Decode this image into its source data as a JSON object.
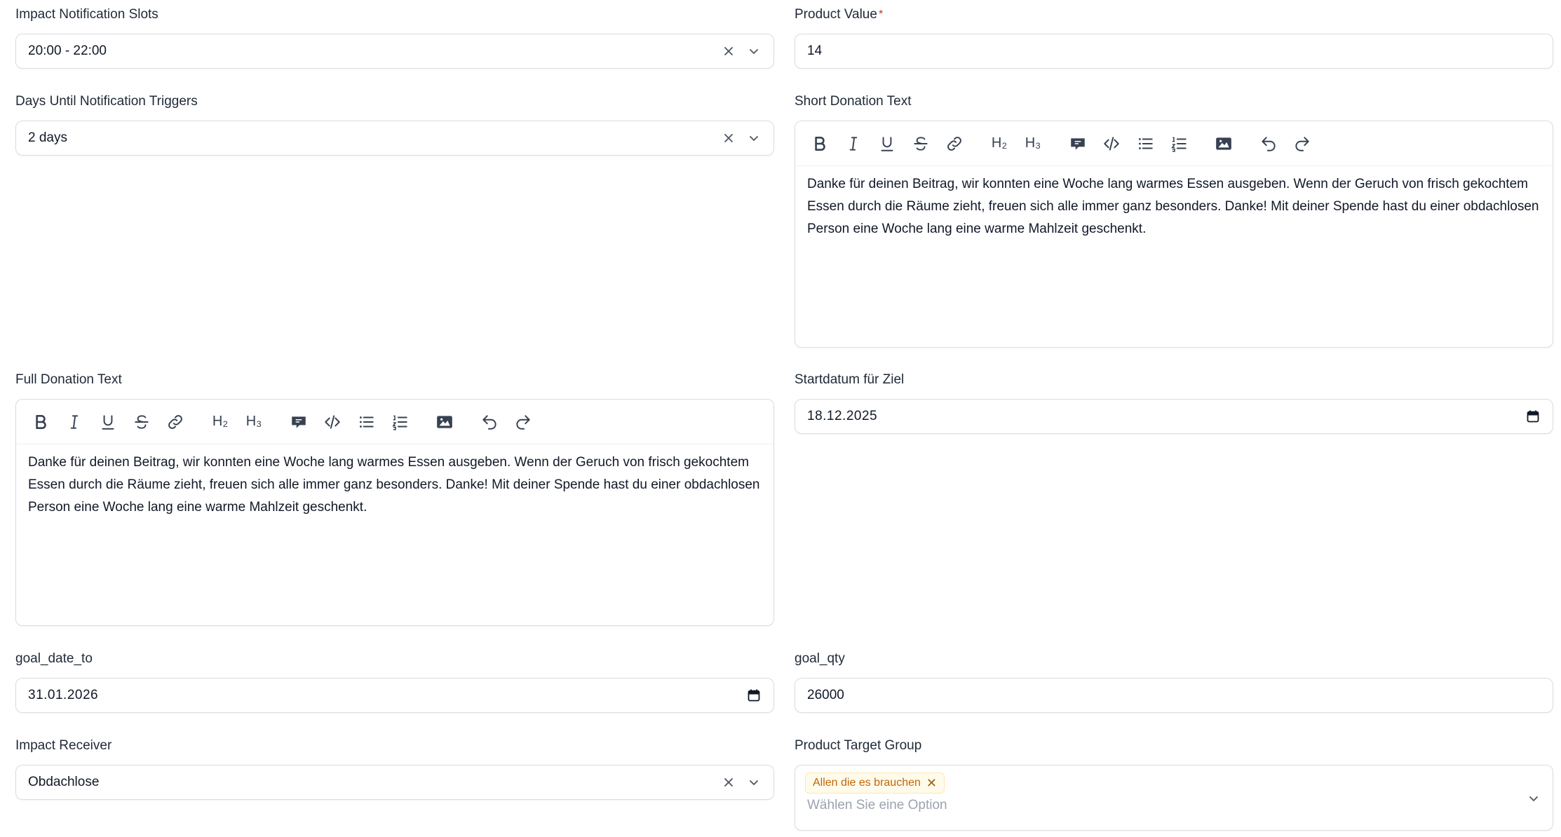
{
  "impact_notification_slots": {
    "label": "Impact Notification Slots",
    "value": "20:00 - 22:00"
  },
  "product_value": {
    "label": "Product Value",
    "required_mark": "*",
    "value": "14"
  },
  "days_until_notification": {
    "label": "Days Until Notification Triggers",
    "value": "2 days"
  },
  "short_donation_text": {
    "label": "Short Donation Text",
    "content": "Danke für deinen Beitrag, wir konnten eine Woche lang warmes Essen ausgeben. Wenn der Geruch von frisch gekochtem Essen durch die Räume zieht, freuen sich alle immer ganz besonders. Danke! Mit deiner Spende hast du einer obdachlosen Person eine Woche lang eine warme Mahlzeit geschenkt."
  },
  "full_donation_text": {
    "label": "Full Donation Text",
    "content": "Danke für deinen Beitrag, wir konnten eine Woche lang warmes Essen ausgeben. Wenn der Geruch von frisch gekochtem Essen durch die Räume zieht, freuen sich alle immer ganz besonders. Danke! Mit deiner Spende hast du einer obdachlosen Person eine Woche lang eine warme Mahlzeit geschenkt."
  },
  "startdatum": {
    "label": "Startdatum für Ziel",
    "value": "18.12.2025"
  },
  "goal_date_to": {
    "label": "goal_date_to",
    "value": "31.01.2026"
  },
  "goal_qty": {
    "label": "goal_qty",
    "value": "26000"
  },
  "impact_receiver": {
    "label": "Impact Receiver",
    "value": "Obdachlose"
  },
  "product_target_group": {
    "label": "Product Target Group",
    "tag": "Allen die es brauchen",
    "placeholder": "Wählen Sie eine Option"
  },
  "toolbar_icons": [
    "bold-icon",
    "italic-icon",
    "underline-icon",
    "strikethrough-icon",
    "link-icon",
    "heading-2-icon",
    "heading-3-icon",
    "blockquote-icon",
    "code-icon",
    "bullet-list-icon",
    "ordered-list-icon",
    "image-icon",
    "undo-icon",
    "redo-icon"
  ],
  "toolbar_labels": {
    "h2": "H₂",
    "h3": "H₃"
  }
}
